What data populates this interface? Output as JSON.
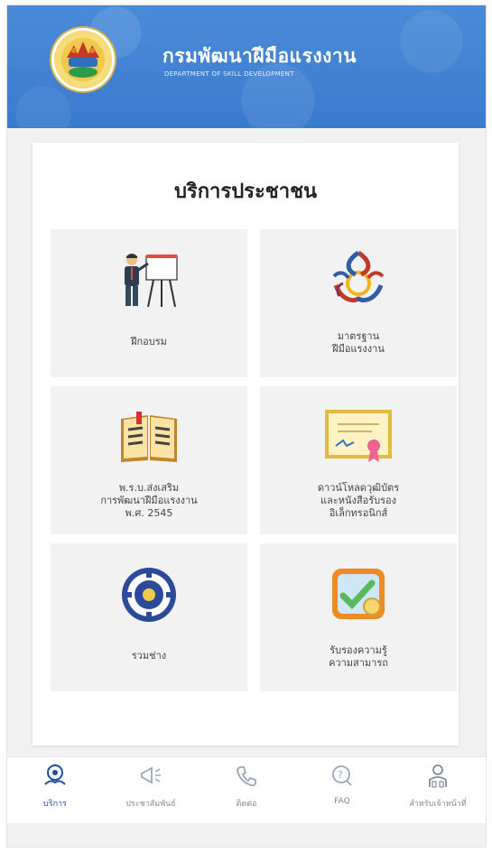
{
  "header": {
    "org_name": "กรมพัฒนาฝีมือแรงงาน",
    "org_subtitle": "DEPARTMENT OF SKILL DEVELOPMENT",
    "logo_icon": "department-emblem-icon"
  },
  "card": {
    "title": "บริการประชาชน",
    "tiles": [
      {
        "label": "ฝึกอบรม",
        "icon": "trainer-presentation-icon"
      },
      {
        "label": "มาตรฐาน\nฝีมือแรงงาน",
        "icon": "thai-standard-emblem-icon"
      },
      {
        "label": "พ.ร.บ.ส่งเสริม\nการพัฒนาฝีมือแรงงาน\nพ.ศ. 2545",
        "icon": "open-book-icon"
      },
      {
        "label": "ดาวน์โหลดวุฒิบัตร\nและหนังสือรับรอง\nอิเล็กทรอนิกส์",
        "icon": "certificate-icon"
      },
      {
        "label": "รวมช่าง",
        "icon": "gear-badge-icon"
      },
      {
        "label": "รับรองความรู้\nความสามารถ",
        "icon": "checklist-certify-icon"
      }
    ]
  },
  "bottom_nav": {
    "items": [
      {
        "label": "บริการ",
        "icon": "services-icon",
        "active": true
      },
      {
        "label": "ประชาสัมพันธ์",
        "icon": "megaphone-icon",
        "active": false
      },
      {
        "label": "ติดต่อ",
        "icon": "phone-icon",
        "active": false
      },
      {
        "label": "FAQ",
        "icon": "faq-bubble-icon",
        "active": false
      },
      {
        "label": "สำหรับเจ้าหน้าที่",
        "icon": "staff-icon",
        "active": false
      }
    ]
  },
  "colors": {
    "header_blue": "#3f82d3",
    "active_nav": "#1f4f9a",
    "tile_bg": "#f2f2f2"
  }
}
